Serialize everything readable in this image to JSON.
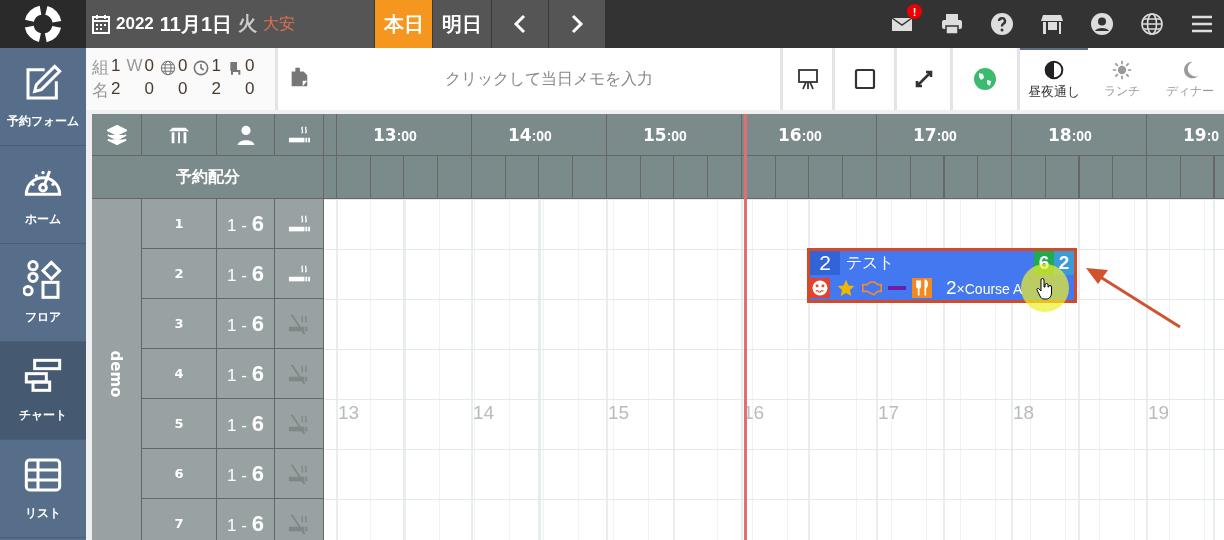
{
  "header": {
    "year": "2022",
    "date": "11月1日",
    "weekday": "火",
    "rokuyo": "大安",
    "today_button": "本日",
    "tomorrow_button": "明日"
  },
  "top_icons": [
    {
      "kind": "mail",
      "badge": "!"
    },
    {
      "kind": "print"
    },
    {
      "kind": "help"
    },
    {
      "kind": "store"
    },
    {
      "kind": "user"
    },
    {
      "kind": "globe"
    },
    {
      "kind": "menu"
    }
  ],
  "sidebar": {
    "items": [
      {
        "kind": "edit",
        "label": "予約フォーム",
        "selected": false
      },
      {
        "kind": "gauge",
        "label": "ホーム",
        "selected": false
      },
      {
        "kind": "shapes",
        "label": "フロア",
        "selected": false
      },
      {
        "kind": "chart",
        "label": "チャート",
        "selected": true
      },
      {
        "kind": "table",
        "label": "リスト",
        "selected": false
      }
    ]
  },
  "stats": {
    "icons": [
      {
        "kind": "text",
        "label": "W"
      },
      {
        "kind": "globe"
      },
      {
        "kind": "clock"
      },
      {
        "kind": "chair"
      }
    ],
    "rows": [
      {
        "label": "組",
        "values": [
          "1",
          "0",
          "0",
          "1",
          "0"
        ]
      },
      {
        "label": "名",
        "values": [
          "2",
          "0",
          "0",
          "2",
          "0"
        ]
      }
    ]
  },
  "memo": {
    "placeholder": "クリックして当日メモを入力"
  },
  "tools": [
    {
      "kind": "presentation"
    },
    {
      "kind": "square"
    },
    {
      "kind": "expand"
    },
    {
      "kind": "globe"
    }
  ],
  "shifts": [
    {
      "kind": "all_day",
      "label": "昼夜通し",
      "selected": true
    },
    {
      "kind": "lunch",
      "label": "ランチ",
      "selected": false
    },
    {
      "kind": "dinner",
      "label": "ディナー",
      "selected": false
    }
  ],
  "chart": {
    "allocation_label": "予約配分",
    "group": "demo",
    "tables": [
      {
        "name": "1",
        "capacity": "1 - **6**",
        "smoking": true
      },
      {
        "name": "2",
        "capacity": "1 - **6**",
        "smoking": true
      },
      {
        "name": "3",
        "capacity": "1 - **6**",
        "smoking": false
      },
      {
        "name": "4",
        "capacity": "1 - **6**",
        "smoking": false
      },
      {
        "name": "5",
        "capacity": "1 - **6**",
        "smoking": false
      },
      {
        "name": "6",
        "capacity": "1 - **6**",
        "smoking": false
      },
      {
        "name": "7",
        "capacity": "1 - **6**",
        "smoking": false
      }
    ],
    "hours": [
      {
        "hour": "13",
        "minutes": ":00"
      },
      {
        "hour": "14",
        "minutes": ":00"
      },
      {
        "hour": "15",
        "minutes": ":00"
      },
      {
        "hour": "16",
        "minutes": ":00"
      },
      {
        "hour": "17",
        "minutes": ":00"
      },
      {
        "hour": "18",
        "minutes": ":00"
      },
      {
        "hour": "19",
        "minutes": ":0"
      }
    ],
    "hour_marks": [
      "13",
      "14",
      "15",
      "16",
      "17",
      "18",
      "19"
    ],
    "reservation": {
      "count": "2",
      "name": "テスト",
      "badges": [
        {
          "text": "6",
          "color": "#22aa4f"
        },
        {
          "text": "2",
          "color": "#3b9bd9"
        }
      ],
      "course": {
        "count": "2",
        "name": "×Course A"
      }
    }
  }
}
